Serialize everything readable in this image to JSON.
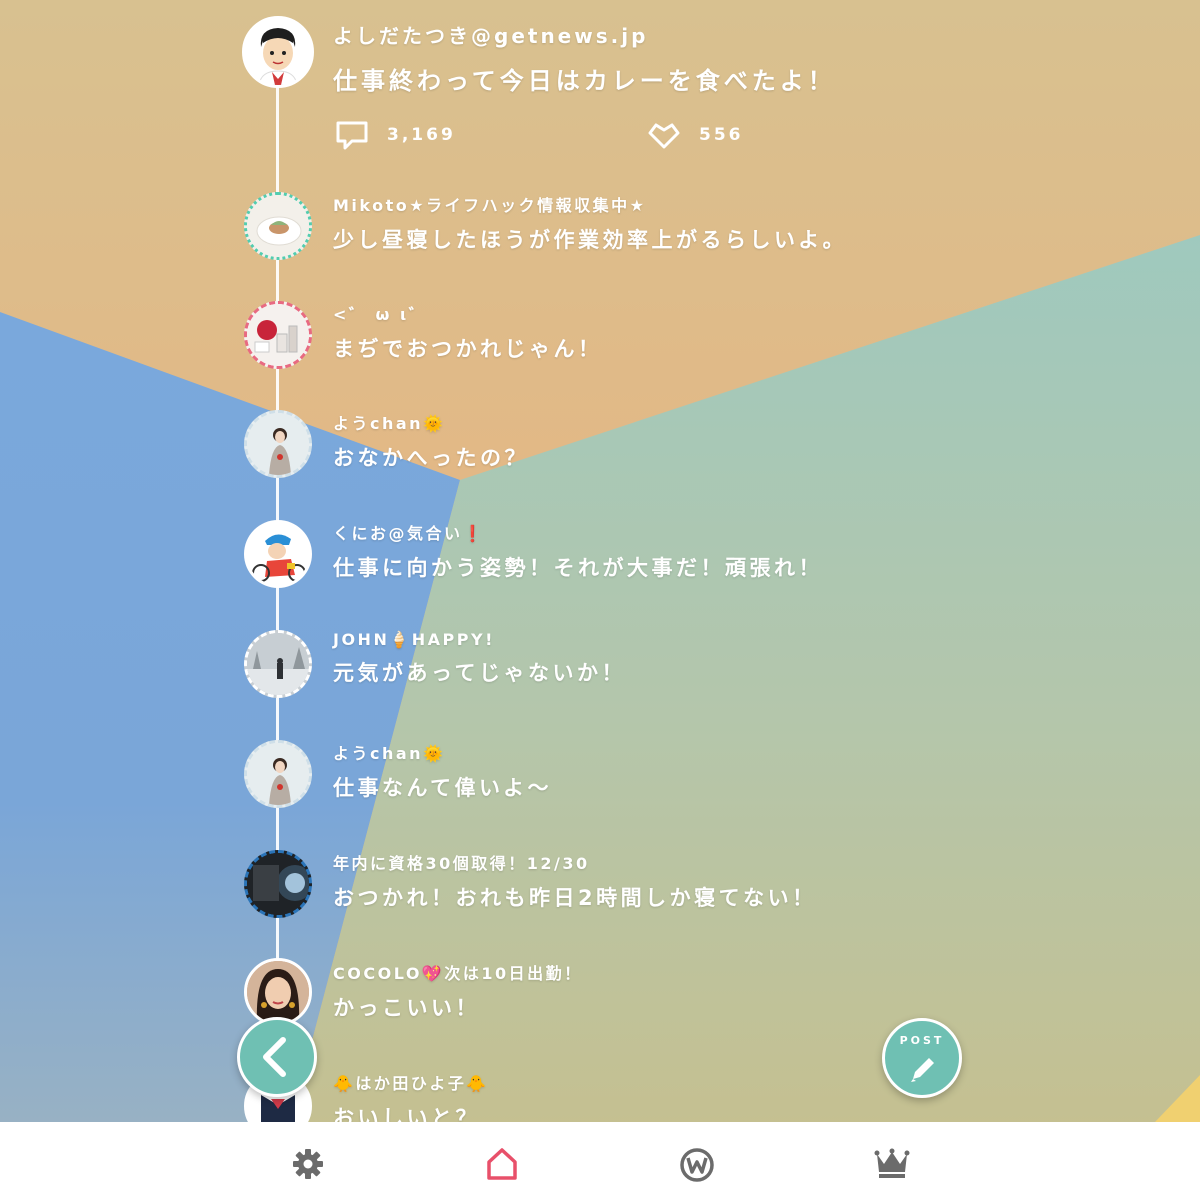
{
  "colors": {
    "accent": "#6fc0b3",
    "home_active": "#e8506a",
    "nav_inactive": "#6b6b6b",
    "bg_orange": "#e8b87a",
    "bg_blue": "#7ea8dd",
    "bg_green": "#a6c8bb"
  },
  "top_post": {
    "user": "よしだたつき@getnews.jp",
    "message": "仕事終わって今日はカレーを食べたよ！",
    "comments_count": "3,169",
    "likes_count": "556",
    "comment_icon": "comment-icon",
    "like_icon": "heart-icon"
  },
  "replies": [
    {
      "user": "Mikoto★ライフハック情報収集中★",
      "message": "少し昼寝したほうが作業効率上がるらしいよ。",
      "avatar": "avatar-food",
      "ring": "#52cdb0"
    },
    {
      "user": "<゛ ω ι゛",
      "message": "まぢでおつかれじゃん！",
      "avatar": "avatar-cosmetics",
      "ring": "#e86a82"
    },
    {
      "user": "ようchan🌞",
      "message": "おなかへったの？",
      "avatar": "avatar-woman",
      "ring": "#cfdfe8"
    },
    {
      "user": "くにお@気合い❗",
      "message": "仕事に向かう姿勢！それが大事だ！頑張れ！",
      "avatar": "avatar-cyclist",
      "ring": "#ffffff"
    },
    {
      "user": "JOHN🍦HAPPY!",
      "message": "元気があってじゃないか！",
      "avatar": "avatar-snow",
      "ring": "#ffffff"
    },
    {
      "user": "ようchan🌞",
      "message": "仕事なんて偉いよ〜",
      "avatar": "avatar-woman",
      "ring": "#cfdfe8"
    },
    {
      "user": "年内に資格30個取得！12/30",
      "message": "おつかれ！おれも昨日2時間しか寝てない！",
      "avatar": "avatar-dark",
      "ring": "#2a74b8"
    },
    {
      "user": "COCOLO💖次は10日出勤！",
      "message": "かっこいい！",
      "avatar": "avatar-portrait",
      "ring": "#ffffff"
    },
    {
      "user": "🐥はか田ひよ子🐥",
      "message": "おいしいと？",
      "avatar": "avatar-uniform",
      "ring": "#ffffff"
    }
  ],
  "buttons": {
    "back_icon": "chevron-left-icon",
    "post_label": "POST",
    "post_icon": "pencil-icon"
  },
  "bottom_nav": [
    {
      "name": "settings",
      "icon": "gear-icon",
      "active": false
    },
    {
      "name": "home",
      "icon": "home-icon",
      "active": true
    },
    {
      "name": "ranking-w",
      "icon": "w-logo-icon",
      "active": false
    },
    {
      "name": "ranking",
      "icon": "crown-icon",
      "active": false
    }
  ]
}
